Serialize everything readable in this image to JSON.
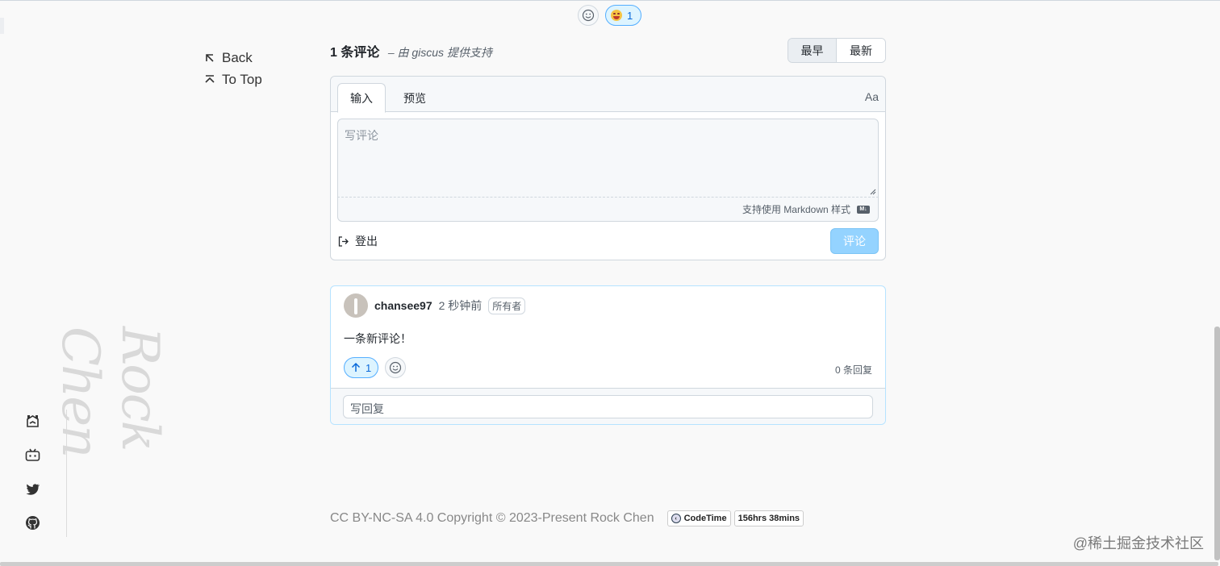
{
  "top_reactions": {
    "count": "1"
  },
  "nav": {
    "back": "Back",
    "to_top": "To Top"
  },
  "giscus": {
    "comment_count": "1 条评论",
    "powered_by": "– 由 giscus 提供支持",
    "sort_oldest": "最早",
    "sort_newest": "最新",
    "tab_write": "输入",
    "tab_preview": "预览",
    "aa_label": "Aa",
    "textarea_placeholder": "写评论",
    "markdown_hint": "支持使用 Markdown 样式",
    "markdown_icon_text": "M↓",
    "signout_label": "登出",
    "submit_label": "评论"
  },
  "comment": {
    "author": "chansee97",
    "time": "2 秒钟前",
    "role_badge": "所有者",
    "body": "一条新评论！",
    "upvotes": "1",
    "reply_count": "0 条回复",
    "reply_placeholder": "写回复"
  },
  "signature": "Rock Chen",
  "footer": {
    "license": "CC BY-NC-SA 4.0 Copyright © 2023-Present Rock Chen",
    "badge_name": "CodeTime",
    "badge_value": "156hrs 38mins"
  },
  "watermark": "@稀土掘金技术社区",
  "colors": {
    "accent": "#0969da",
    "submit_disabled": "#94d3ff",
    "background": "#f9f9f9"
  }
}
